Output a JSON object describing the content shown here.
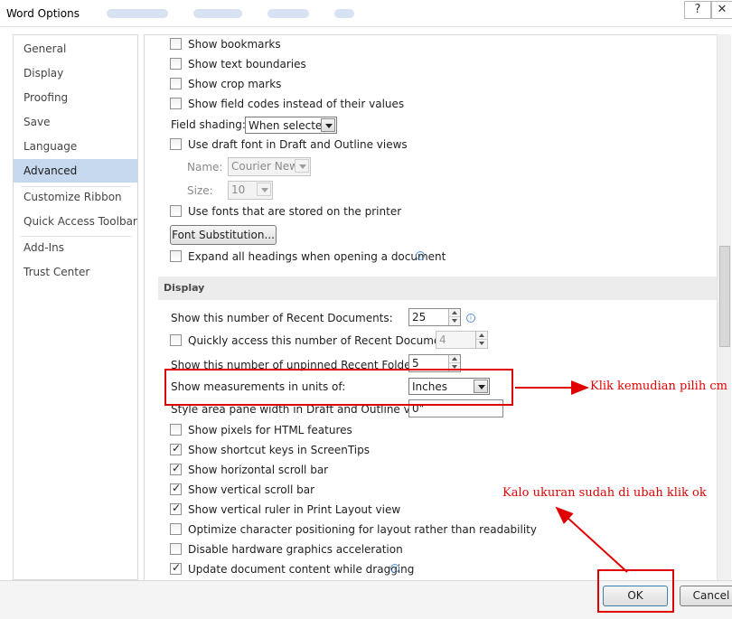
{
  "window": {
    "title": "Word Options",
    "help_glyph": "?",
    "close_glyph": "✕"
  },
  "nav": {
    "items": [
      {
        "label": "General"
      },
      {
        "label": "Display"
      },
      {
        "label": "Proofing"
      },
      {
        "label": "Save"
      },
      {
        "label": "Language"
      },
      {
        "label": "Advanced",
        "selected": true
      },
      {
        "label": "Customize Ribbon"
      },
      {
        "label": "Quick Access Toolbar"
      },
      {
        "label": "Add-Ins"
      },
      {
        "label": "Trust Center"
      }
    ]
  },
  "content": {
    "show_bookmarks": {
      "label": "Show bookmarks",
      "checked": false
    },
    "show_text_boundaries": {
      "label": "Show text boundaries",
      "checked": false
    },
    "show_crop_marks": {
      "label": "Show crop marks",
      "checked": false
    },
    "show_field_codes": {
      "label": "Show field codes instead of their values",
      "checked": false
    },
    "field_shading": {
      "label": "Field shading:",
      "value": "When selected"
    },
    "draft_font": {
      "label": "Use draft font in Draft and Outline views",
      "checked": false
    },
    "name": {
      "label": "Name:",
      "value": "Courier New"
    },
    "size": {
      "label": "Size:",
      "value": "10"
    },
    "printer_fonts": {
      "label": "Use fonts that are stored on the printer",
      "checked": false
    },
    "font_substitution_button": "Font Substitution...",
    "expand_headings": {
      "label": "Expand all headings when opening a document",
      "checked": false
    },
    "display_section": "Display",
    "recent_documents": {
      "label": "Show this number of Recent Documents:",
      "value": "25"
    },
    "quick_access": {
      "label": "Quickly access this number of Recent Documents:",
      "value": "4",
      "checked": false
    },
    "unpinned_folders": {
      "label": "Show this number of unpinned Recent Folders:",
      "value": "5"
    },
    "measurements": {
      "label": "Show measurements in units of:",
      "value": "Inches"
    },
    "style_area": {
      "label": "Style area pane width in Draft and Outline views:",
      "value": "0\""
    },
    "show_pixels": {
      "label": "Show pixels for HTML features",
      "checked": false
    },
    "shortcut_keys": {
      "label": "Show shortcut keys in ScreenTips",
      "checked": true
    },
    "horizontal_scroll": {
      "label": "Show horizontal scroll bar",
      "checked": true
    },
    "vertical_scroll": {
      "label": "Show vertical scroll bar",
      "checked": true
    },
    "vertical_ruler": {
      "label": "Show vertical ruler in Print Layout view",
      "checked": true
    },
    "optimize_positioning": {
      "label": "Optimize character positioning for layout rather than readability",
      "checked": false
    },
    "disable_hw_accel": {
      "label": "Disable hardware graphics acceleration",
      "checked": false
    },
    "update_dragging": {
      "label": "Update document content while dragging",
      "checked": true
    }
  },
  "footer": {
    "ok": "OK",
    "cancel": "Cancel"
  },
  "annotations": {
    "units_note": "Klik kemudian pilih cm",
    "ok_note": "Kalo ukuran sudah di ubah klik ok",
    "color": "#e00000"
  }
}
